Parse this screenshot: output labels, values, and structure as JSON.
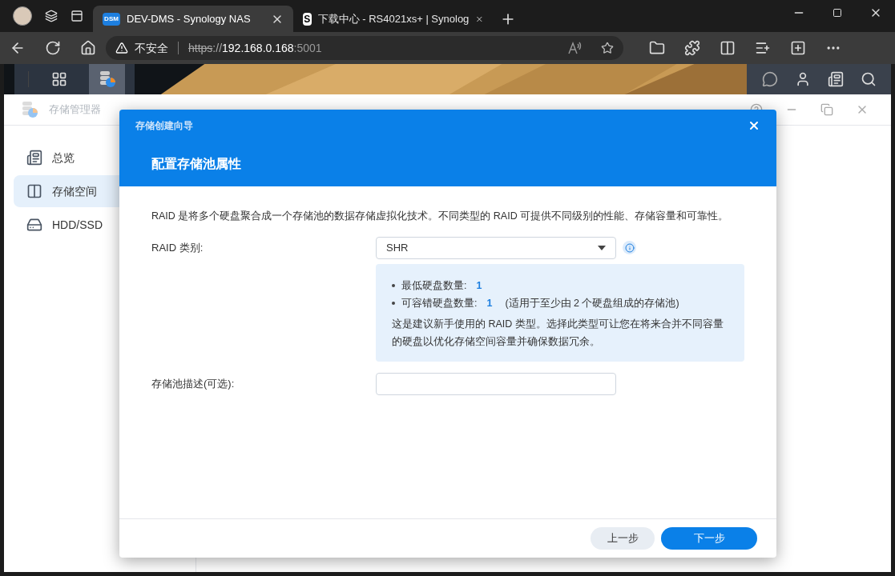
{
  "browser": {
    "tabs": [
      {
        "label": "DEV-DMS - Synology NAS",
        "icon": "DSM",
        "selected": true
      },
      {
        "label": "下载中心 - RS4021xs+ | Synolog",
        "icon": "S",
        "selected": false
      }
    ],
    "address": {
      "security": "不安全",
      "scheme": "https",
      "host": "://192.168.0.168",
      "port": ":5001"
    }
  },
  "app_window": {
    "title": "存储管理器",
    "sidebar": [
      {
        "label": "总览",
        "kind": "overview",
        "selected": false
      },
      {
        "label": "存储空间",
        "kind": "storage",
        "selected": true
      },
      {
        "label": "HDD/SSD",
        "kind": "disk",
        "selected": false
      }
    ]
  },
  "dialog": {
    "title": "存储创建向导",
    "heading": "配置存储池属性",
    "intro": "RAID 是将多个硬盘聚合成一个存储池的数据存储虚拟化技术。不同类型的 RAID 可提供不同级别的性能、存储容量和可靠性。",
    "raid_label": "RAID 类别:",
    "raid_value": "SHR",
    "info": {
      "bullets": [
        {
          "label": "最低硬盘数量:",
          "value": "1"
        },
        {
          "label": "可容错硬盘数量:",
          "value": "1",
          "note": "(适用于至少由 2 个硬盘组成的存储池)"
        }
      ],
      "text": "这是建议新手使用的 RAID 类型。选择此类型可让您在将来合并不同容量的硬盘以优化存储空间容量并确保数据冗余。"
    },
    "description_label": "存储池描述(可选):",
    "buttons": [
      {
        "label": "上一步",
        "kind": "secondary"
      },
      {
        "label": "下一步",
        "kind": "primary"
      }
    ]
  }
}
